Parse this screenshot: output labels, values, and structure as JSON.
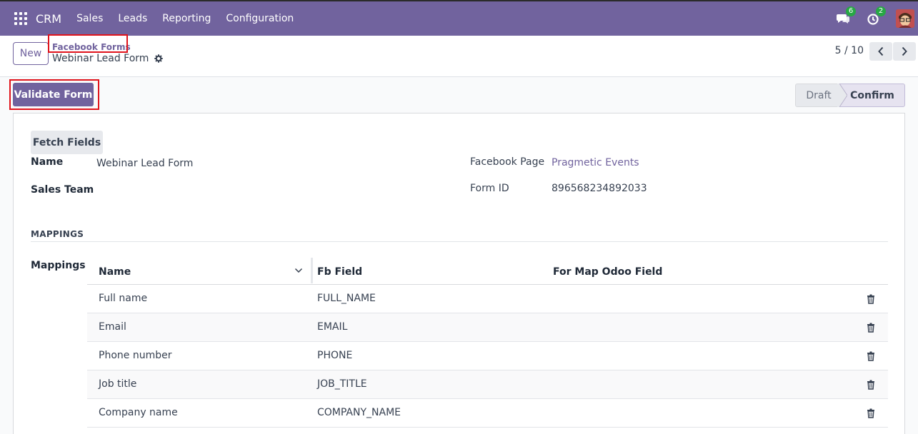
{
  "navbar": {
    "brand": "CRM",
    "menu": [
      "Sales",
      "Leads",
      "Reporting",
      "Configuration"
    ],
    "messages_count": "6",
    "activities_count": "2"
  },
  "control_panel": {
    "new_label": "New",
    "breadcrumb_parent": "Facebook Forms",
    "record_title": "Webinar Lead Form",
    "pager": "5 / 10"
  },
  "statusbar": {
    "validate_label": "Validate Form",
    "stages": [
      "Draft",
      "Confirm"
    ],
    "current_stage": "Confirm"
  },
  "form": {
    "fetch_label": "Fetch Fields",
    "name_label": "Name",
    "name_value": "Webinar Lead Form",
    "sales_team_label": "Sales Team",
    "sales_team_value": "",
    "facebook_page_label": "Facebook Page",
    "facebook_page_value": "Pragmetic Events",
    "form_id_label": "Form ID",
    "form_id_value": "896568234892033",
    "section_title": "MAPPINGS",
    "mappings_label": "Mappings"
  },
  "mappings_table": {
    "headers": [
      "Name",
      "Fb Field",
      "For Map Odoo Field"
    ],
    "rows": [
      {
        "name": "Full name",
        "fb_field": "FULL_NAME",
        "odoo_field": ""
      },
      {
        "name": "Email",
        "fb_field": "EMAIL",
        "odoo_field": ""
      },
      {
        "name": "Phone number",
        "fb_field": "PHONE",
        "odoo_field": ""
      },
      {
        "name": "Job title",
        "fb_field": "JOB_TITLE",
        "odoo_field": ""
      },
      {
        "name": "Company name",
        "fb_field": "COMPANY_NAME",
        "odoo_field": ""
      }
    ]
  },
  "colors": {
    "brand": "#71639e",
    "highlight": "#e0131b",
    "badge": "#28a745"
  }
}
